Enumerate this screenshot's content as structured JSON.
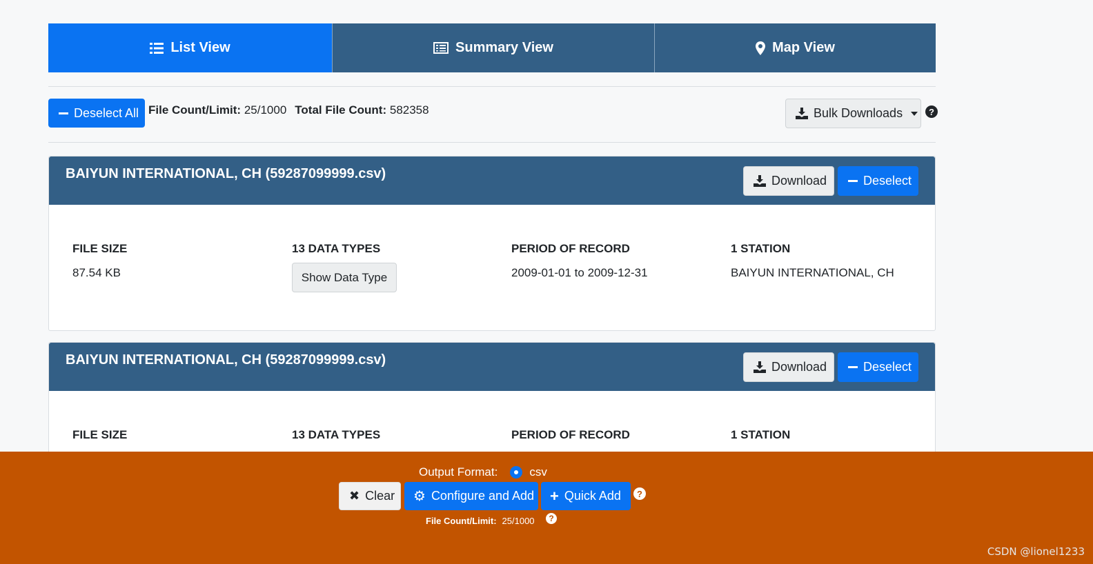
{
  "tabs": [
    {
      "label": "List View",
      "icon": "list-icon",
      "active": true
    },
    {
      "label": "Summary View",
      "icon": "summary-icon",
      "active": false
    },
    {
      "label": "Map View",
      "icon": "map-marker-icon",
      "active": false
    }
  ],
  "toolbar": {
    "deselect_all_label": "Deselect All",
    "file_count_label": "File Count/Limit:",
    "file_count_value": "25/1000",
    "total_count_label": "Total File Count:",
    "total_count_value": "582358",
    "bulk_downloads_label": "Bulk Downloads"
  },
  "cards": [
    {
      "title": "BAIYUN INTERNATIONAL, CH (59287099999.csv)",
      "download_label": "Download",
      "deselect_label": "Deselect",
      "file_size_label": "FILE SIZE",
      "file_size_value": "87.54 KB",
      "data_types_label": "13 DATA TYPES",
      "show_data_type_label": "Show Data Type",
      "period_label": "PERIOD OF RECORD",
      "period_value": "2009-01-01 to 2009-12-31",
      "station_label": "1 STATION",
      "station_value": "BAIYUN INTERNATIONAL, CH"
    },
    {
      "title": "BAIYUN INTERNATIONAL, CH (59287099999.csv)",
      "download_label": "Download",
      "deselect_label": "Deselect",
      "file_size_label": "FILE SIZE",
      "data_types_label": "13 DATA TYPES",
      "period_label": "PERIOD OF RECORD",
      "station_label": "1 STATION"
    }
  ],
  "footer": {
    "output_format_label": "Output Format:",
    "output_format_value": "csv",
    "clear_label": "Clear",
    "configure_label": "Configure and Add",
    "quick_add_label": "Quick Add",
    "file_count_label": "File Count/Limit:",
    "file_count_value": "25/1000"
  },
  "watermark": "CSDN @lionel1233",
  "colors": {
    "primary": "#0a73f2",
    "header": "#335f86",
    "footer": "#c25400"
  }
}
